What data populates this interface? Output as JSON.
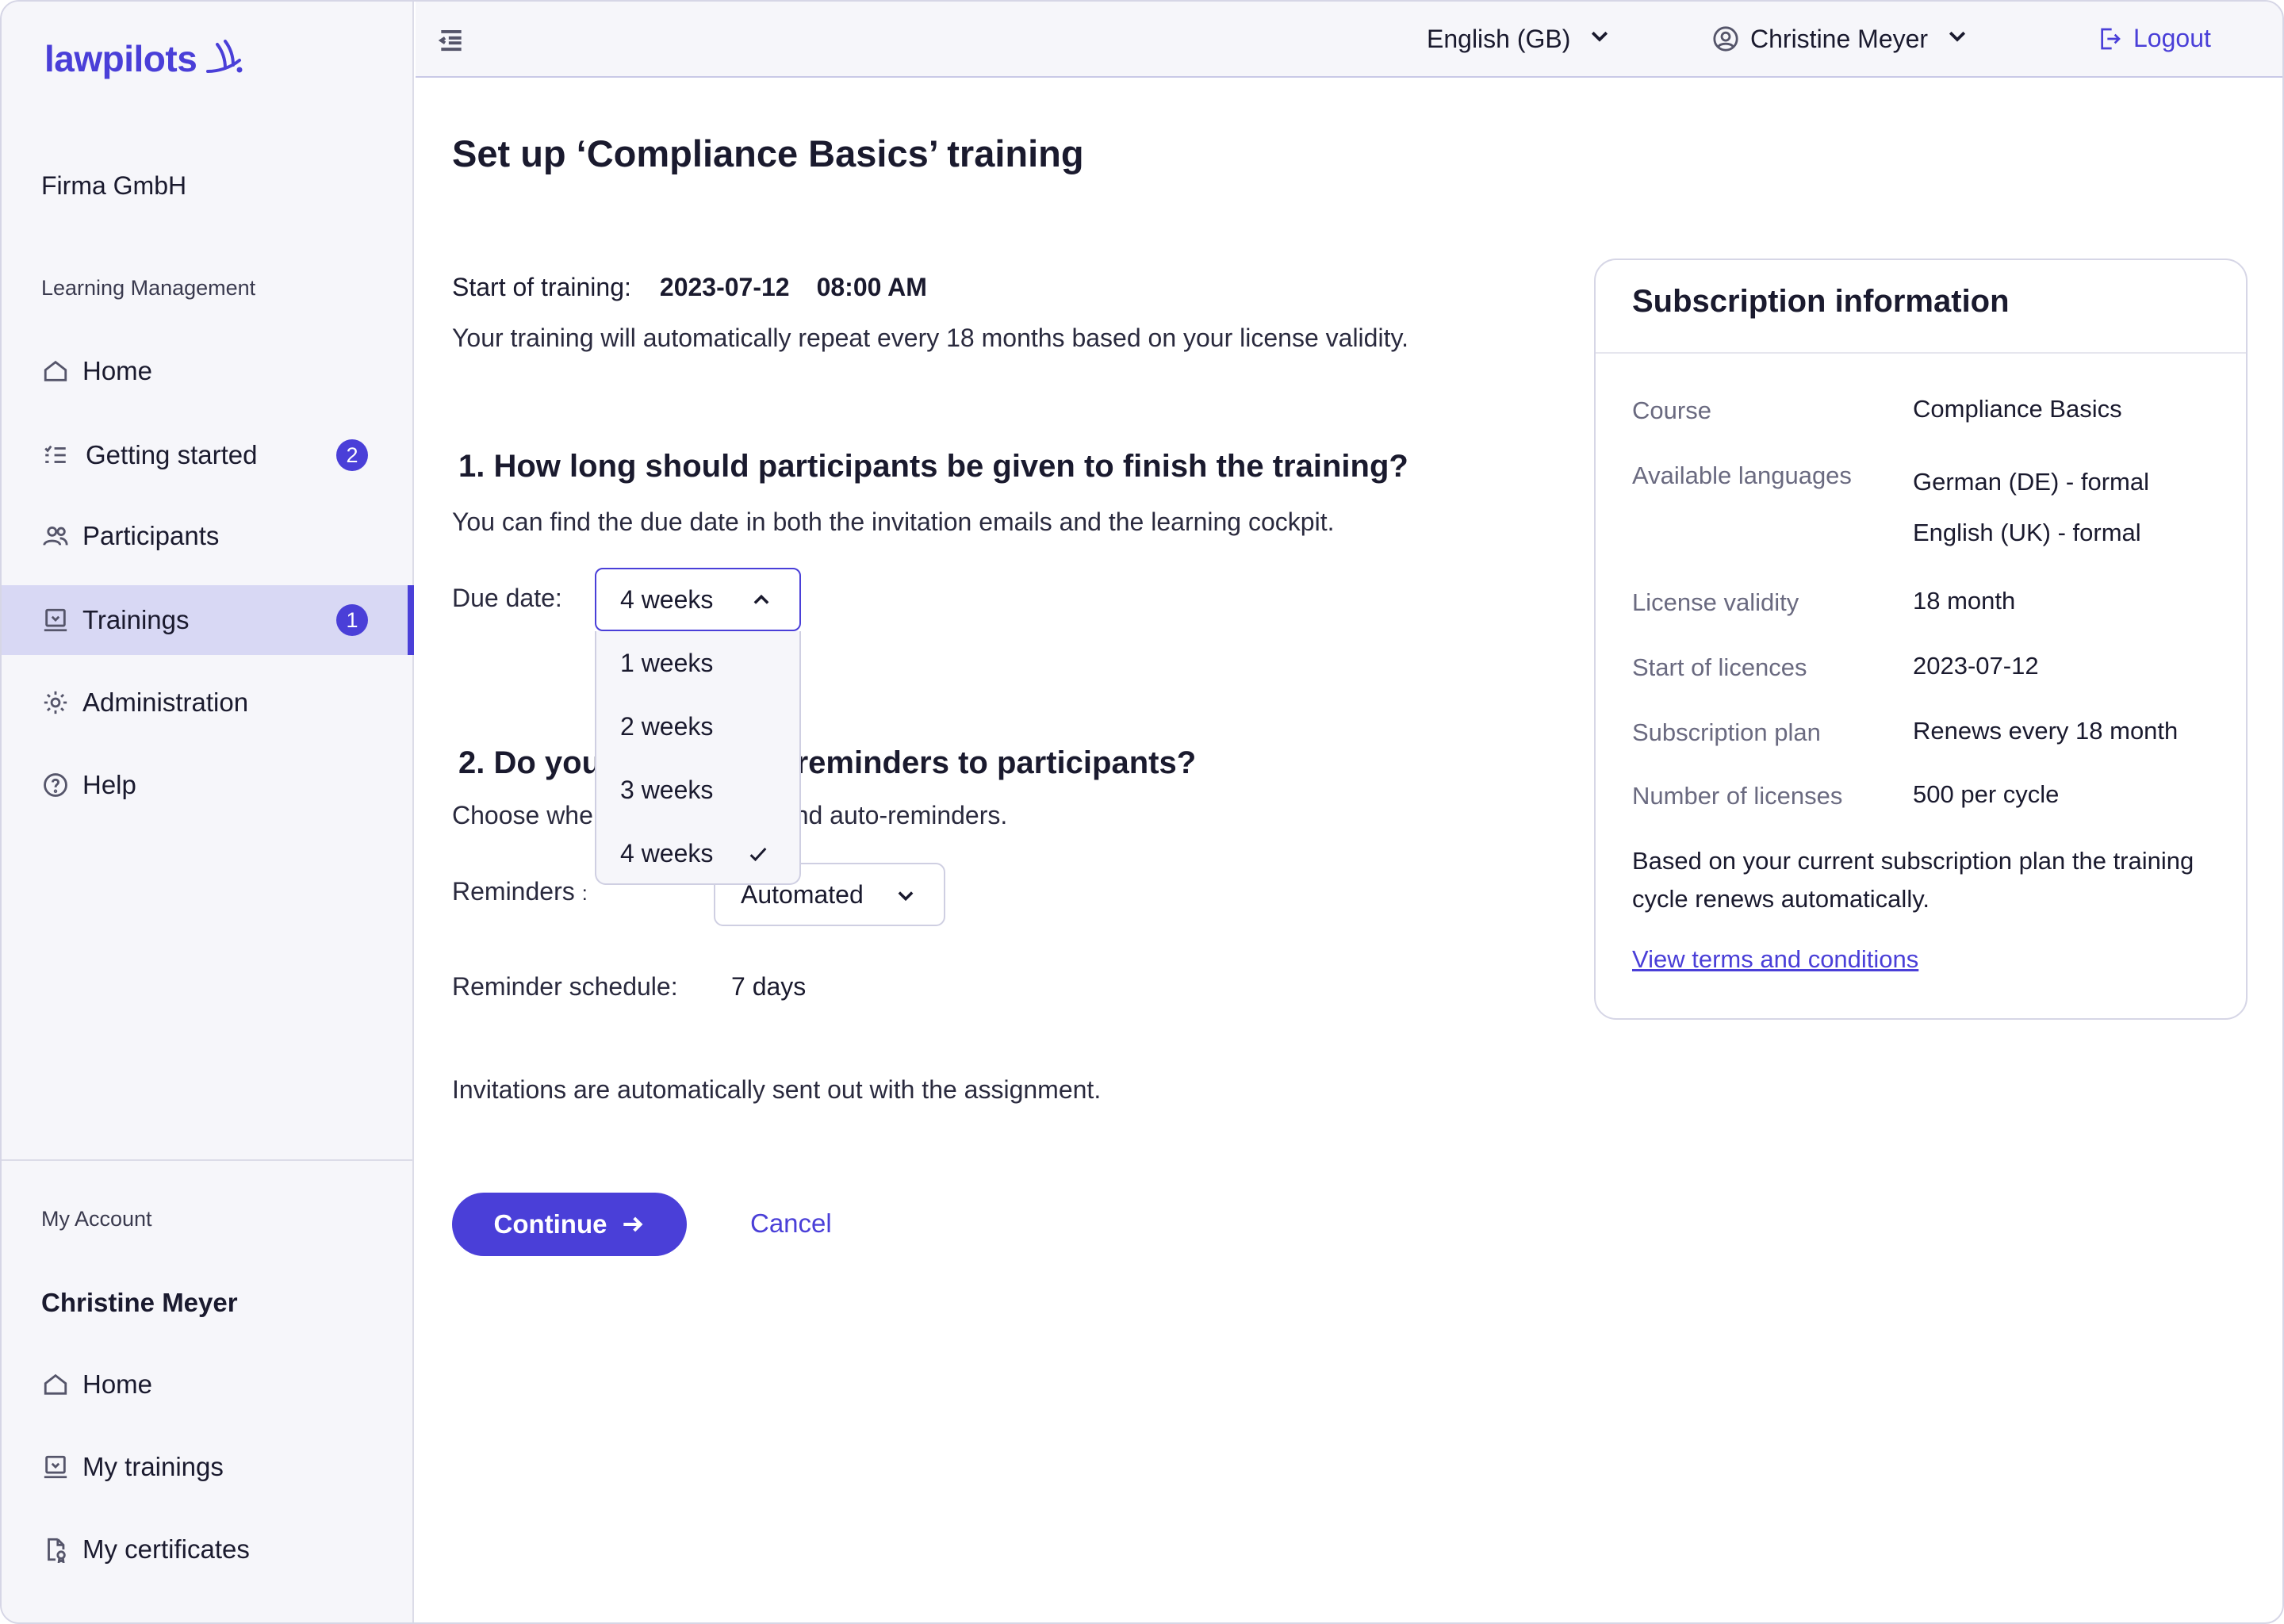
{
  "sidebar": {
    "logo_text": "lawpilots",
    "company": "Firma GmbH",
    "section_learning": "Learning Management",
    "items": [
      {
        "label": "Home",
        "icon": "home-icon"
      },
      {
        "label": "Getting started",
        "icon": "checklist-icon",
        "badge": "2"
      },
      {
        "label": "Participants",
        "icon": "users-icon"
      },
      {
        "label": "Trainings",
        "icon": "training-icon",
        "badge": "1",
        "active": true
      },
      {
        "label": "Administration",
        "icon": "gear-icon"
      },
      {
        "label": "Help",
        "icon": "help-icon"
      }
    ],
    "section_account": "My Account",
    "account_name": "Christine Meyer",
    "account_items": [
      {
        "label": "Home",
        "icon": "home-icon"
      },
      {
        "label": "My trainings",
        "icon": "training-icon"
      },
      {
        "label": "My certificates",
        "icon": "certificate-icon"
      }
    ]
  },
  "topbar": {
    "language": "English (GB)",
    "user": "Christine Meyer",
    "logout": "Logout"
  },
  "main": {
    "title": "Set up ‘Compliance Basics’ training",
    "start_label": "Start of training:",
    "start_date": "2023-07-12",
    "start_time": "08:00 AM",
    "repeat_note": "Your training will automatically repeat every 18 months based on your license validity.",
    "q1_title": "1. How long should participants be given to finish the training?",
    "q1_sub": "You can find the due date in both the invitation emails and the learning cockpit.",
    "due_label": "Due date:",
    "due_selected": "4 weeks",
    "due_options": [
      "1 weeks",
      "2 weeks",
      "3 weeks",
      "4 weeks"
    ],
    "q2_title_a": "2. Do you",
    "q2_title_b": "d reminders to participants?",
    "q2_sub_a": "Choose whe",
    "q2_sub_b": "send auto-reminders.",
    "reminders_label": "Reminders",
    "reminders_colon": ":",
    "reminders_value": "Automated",
    "schedule_label": "Reminder schedule:",
    "schedule_value": "7 days",
    "invites_note": "Invitations are automatically sent out with the assignment.",
    "continue_label": "Continue",
    "cancel_label": "Cancel"
  },
  "subscription": {
    "title": "Subscription information",
    "rows": [
      {
        "label": "Course",
        "value": "Compliance Basics"
      },
      {
        "label": "Available languages",
        "value": "German (DE) - formal",
        "value2": "English (UK) - formal"
      },
      {
        "label": "License validity",
        "value": "18 month"
      },
      {
        "label": "Start of licences",
        "value": "2023-07-12"
      },
      {
        "label": "Subscription plan",
        "value": "Renews every 18 month"
      },
      {
        "label": "Number of licenses",
        "value": "500 per cycle"
      }
    ],
    "note": "Based on your current subscription plan the training cycle renews automatically.",
    "terms_link": "View terms and conditions"
  },
  "colors": {
    "accent": "#4a3fd8",
    "sidebar_bg": "#f6f6fa",
    "active_bg": "#d8d8f4"
  }
}
